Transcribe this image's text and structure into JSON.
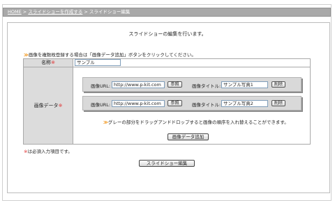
{
  "breadcrumb": {
    "home": "HOME",
    "sep1": " > ",
    "create": "スライドショーを作成する",
    "sep2": " > ",
    "current": "スライドショー編集"
  },
  "intro": "スライドショーの編集を行います。",
  "note": {
    "arrow": "≫",
    "text": "画像を複数枚登録する場合は「画像データ追加」ボタンをクリックしてください。"
  },
  "form": {
    "name_label": "名称",
    "name_value": "サンプル",
    "required_mark": "※",
    "image_label": "画像データ",
    "rows": [
      {
        "url_label": "画像URL:",
        "url_value": "http://www.p-kit.com",
        "browse": "参照",
        "title_label": "画像タイトル:",
        "title_value": "サンプル写真1",
        "delete": "削除"
      },
      {
        "url_label": "画像URL:",
        "url_value": "http://www.p-kit.com",
        "browse": "参照",
        "title_label": "画像タイトル:",
        "title_value": "サンプル写真2",
        "delete": "削除"
      }
    ],
    "hint_arrow": "≫",
    "hint": "グレーの部分をドラッグアンドドロップすると画像の順序を入れ替えることができます。",
    "add_button": "画像データ追加"
  },
  "required_note": {
    "mark": "※",
    "text": "は必須入力項目です。"
  },
  "submit_button": "スライドショー編集"
}
